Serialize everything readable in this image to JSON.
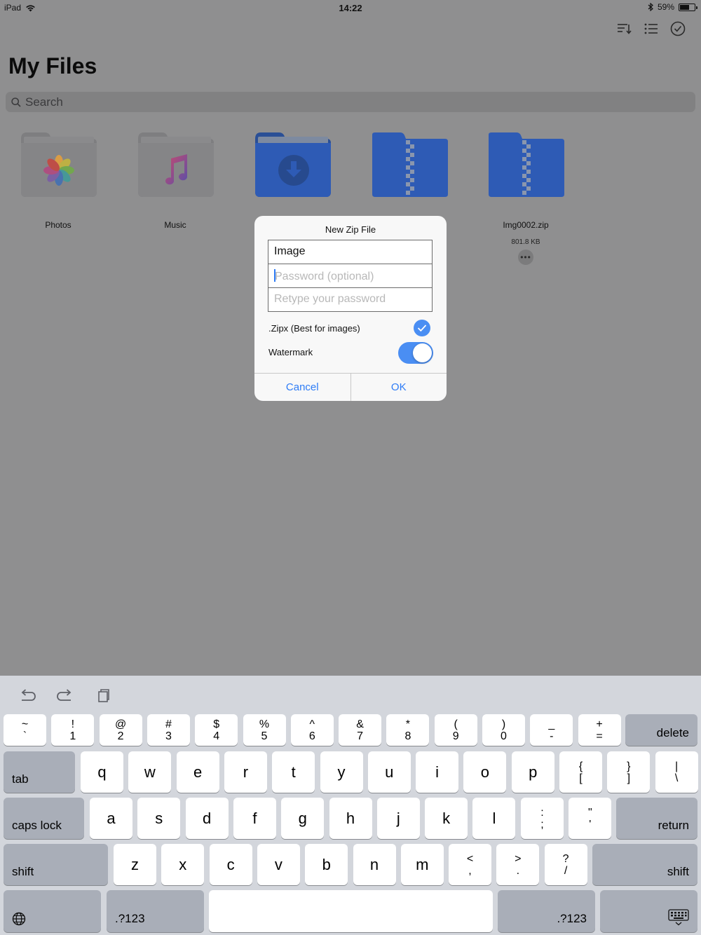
{
  "status_bar": {
    "device": "iPad",
    "time": "14:22",
    "battery": "59%",
    "battery_level": 0.59
  },
  "header": {
    "title": "My Files"
  },
  "search": {
    "placeholder": "Search"
  },
  "files": [
    {
      "name": "Photos",
      "size": ""
    },
    {
      "name": "Music",
      "size": ""
    },
    {
      "name": "",
      "size": ""
    },
    {
      "name": "",
      "size": ""
    },
    {
      "name": "Img0002.zip",
      "size": "801.8 KB"
    }
  ],
  "dialog": {
    "title": "New Zip File",
    "name_value": "Image",
    "password_placeholder": "Password (optional)",
    "retype_placeholder": "Retype your password",
    "zipx_label": ".Zipx (Best for images)",
    "zipx_checked": true,
    "watermark_label": "Watermark",
    "watermark_on": true,
    "cancel_label": "Cancel",
    "ok_label": "OK"
  },
  "keyboard": {
    "row1": [
      [
        "~",
        "`"
      ],
      [
        "!",
        "1"
      ],
      [
        "@",
        "2"
      ],
      [
        "#",
        "3"
      ],
      [
        "$",
        "4"
      ],
      [
        "%",
        "5"
      ],
      [
        "^",
        "6"
      ],
      [
        "&",
        "7"
      ],
      [
        "*",
        "8"
      ],
      [
        "(",
        "9"
      ],
      [
        ")",
        "0"
      ],
      [
        "_",
        "-"
      ],
      [
        "+",
        "="
      ]
    ],
    "delete": "delete",
    "tab": "tab",
    "row2": [
      "q",
      "w",
      "e",
      "r",
      "t",
      "y",
      "u",
      "i",
      "o",
      "p"
    ],
    "row2_sym": [
      [
        "{",
        "["
      ],
      [
        "}",
        "]"
      ],
      [
        "|",
        "\\"
      ]
    ],
    "caps": "caps lock",
    "row3": [
      "a",
      "s",
      "d",
      "f",
      "g",
      "h",
      "j",
      "k",
      "l"
    ],
    "row3_sym": [
      [
        ":",
        ";"
      ],
      [
        "\"",
        "'"
      ]
    ],
    "return": "return",
    "shift": "shift",
    "row4": [
      "z",
      "x",
      "c",
      "v",
      "b",
      "n",
      "m"
    ],
    "row4_sym": [
      [
        "<",
        ","
      ],
      [
        ">",
        "."
      ],
      [
        "?",
        "/"
      ]
    ],
    "numbers": ".?123",
    "space": ""
  },
  "colors": {
    "accent": "#2e7cf6",
    "folder_blue": "#2e5bb5",
    "dim_overlay": "#8f8f90",
    "keyboard_bg": "#d3d6dc"
  }
}
